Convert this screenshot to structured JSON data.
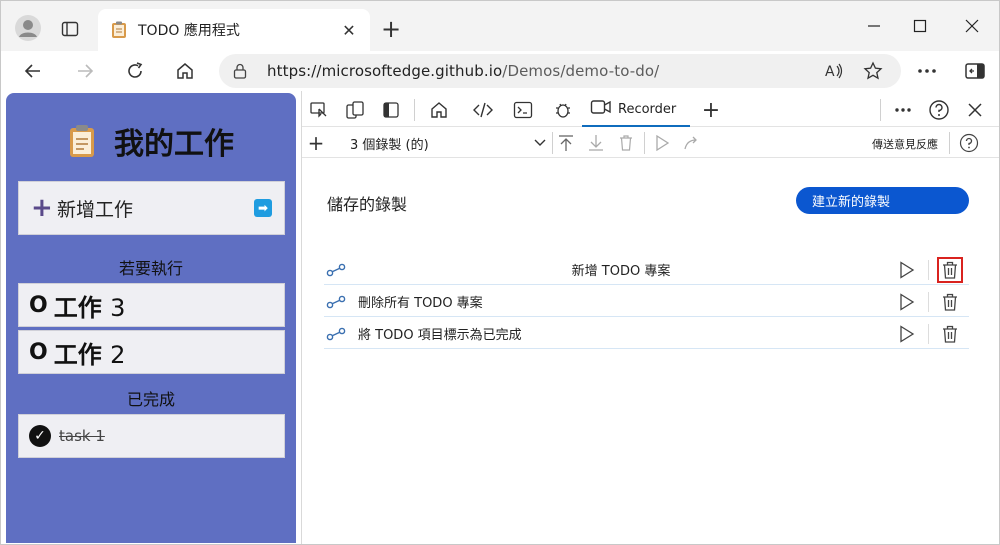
{
  "browser": {
    "tab_title": "TODO 應用程式",
    "url_host": "https://microsoftedge.github.io",
    "url_path": "/Demos/demo-to-do/"
  },
  "app": {
    "title": "我的工作",
    "add_task_label": "新增工作",
    "todo_heading": "若要執行",
    "tasks": [
      {
        "label": "工作",
        "num": "3"
      },
      {
        "label": "工作",
        "num": "2"
      }
    ],
    "done_heading": "已完成",
    "done_tasks": [
      {
        "label": "task 1"
      }
    ]
  },
  "devtools": {
    "active_tab": "Recorder",
    "recording_select": "3 個錄製 (的)",
    "feedback_label": "傳送意見反應",
    "saved_heading": "儲存的錄製",
    "create_button": "建立新的錄製",
    "recordings": [
      {
        "name": "新增 TODO 專案",
        "highlighted_delete": true
      },
      {
        "name": "刪除所有 TODO 專案",
        "highlighted_delete": false
      },
      {
        "name": "將 TODO 項目標示為已完成",
        "highlighted_delete": false
      }
    ]
  },
  "colors": {
    "app_bg": "#5f6fc2",
    "accent": "#0b57d0",
    "highlight": "#d9231f"
  }
}
